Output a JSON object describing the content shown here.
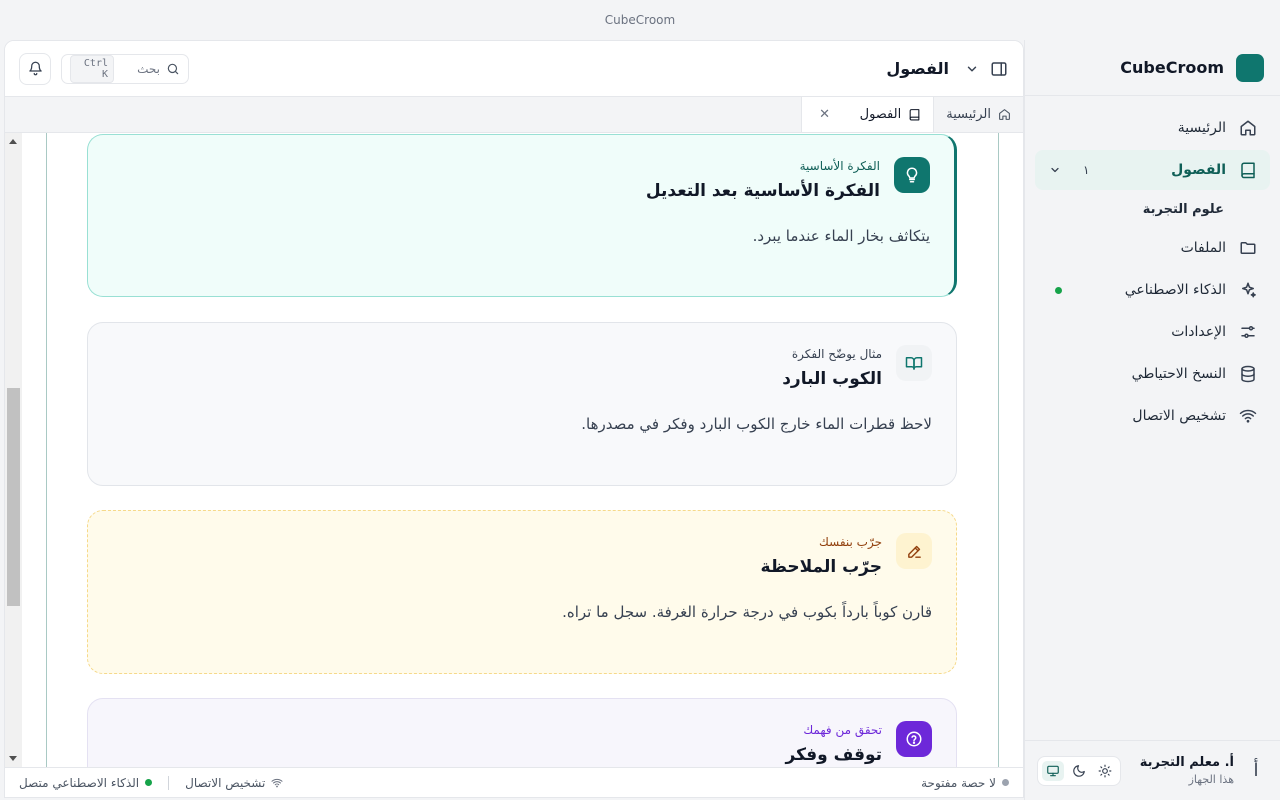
{
  "window": {
    "title": "CubeCroom"
  },
  "brand": {
    "name": "CubeCroom"
  },
  "sidebar": {
    "items": [
      {
        "label": "الرئيسية",
        "icon": "home-icon"
      },
      {
        "label": "الفصول",
        "icon": "book-icon",
        "count": "١",
        "active": true
      },
      {
        "label": "الملفات",
        "icon": "folder-icon"
      },
      {
        "label": "الذكاء الاصطناعي",
        "icon": "sparkles-icon"
      },
      {
        "label": "الإعدادات",
        "icon": "sliders-icon"
      },
      {
        "label": "النسخ الاحتياطي",
        "icon": "database-icon"
      },
      {
        "label": "تشخيص الاتصال",
        "icon": "wifi-icon"
      }
    ],
    "sub_item": "علوم التجربة",
    "user": {
      "initial": "أ",
      "name": "أ. معلم التجربة",
      "device": "هذا الجهاز"
    }
  },
  "header": {
    "title": "الفصول",
    "search_placeholder": "بحث",
    "shortcut": "Ctrl K"
  },
  "tabs": [
    {
      "label": "الرئيسية",
      "icon": "home-icon"
    },
    {
      "label": "الفصول",
      "icon": "book-icon",
      "active": true
    }
  ],
  "cards": {
    "idea": {
      "kicker": "الفكرة الأساسية",
      "title": "الفكرة الأساسية بعد التعديل",
      "body": "يتكاثف بخار الماء عندما يبرد."
    },
    "example": {
      "kicker": "مثال يوضّح الفكرة",
      "title": "الكوب البارد",
      "body": "لاحظ قطرات الماء خارج الكوب البارد وفكر في مصدرها."
    },
    "try": {
      "kicker": "جرّب بنفسك",
      "title": "جرّب الملاحظة",
      "body": "قارن كوباً بارداً بكوب في درجة حرارة الغرفة. سجل ما تراه."
    },
    "check": {
      "kicker": "تحقق من فهمك",
      "title": "توقف وفكر"
    }
  },
  "status": {
    "session": "لا حصة مفتوحة",
    "connection": "تشخيص الاتصال",
    "ai": "الذكاء الاصطناعي متصل"
  },
  "colors": {
    "accent": "#0f766e",
    "purple": "#6d28d9",
    "amber": "#92400e",
    "online": "#16a34a"
  }
}
